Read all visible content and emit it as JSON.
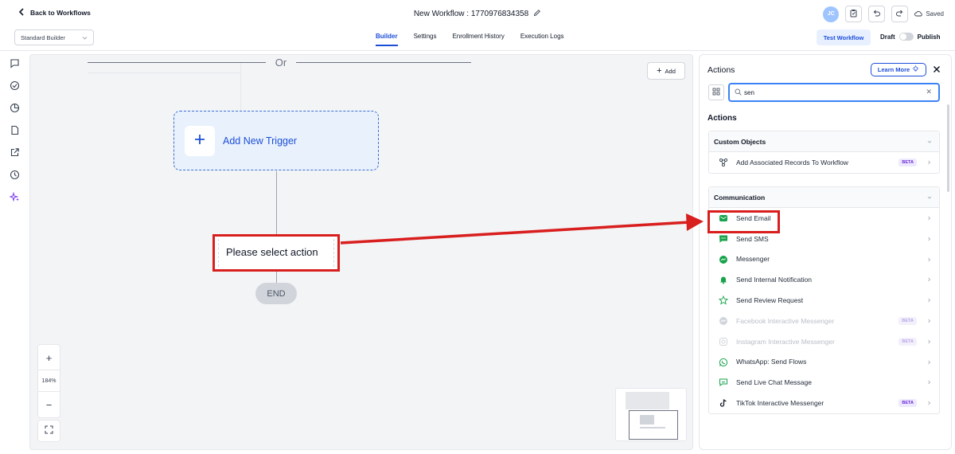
{
  "header": {
    "back_label": "Back to Workflows",
    "workflow_title": "New Workflow : 1770976834358",
    "avatar_initials": "JC",
    "saved_label": "Saved"
  },
  "subbar": {
    "builder_select": "Standard Builder",
    "tabs": [
      {
        "label": "Builder",
        "active": true
      },
      {
        "label": "Settings",
        "active": false
      },
      {
        "label": "Enrollment History",
        "active": false
      },
      {
        "label": "Execution Logs",
        "active": false
      }
    ],
    "test_button": "Test Workflow",
    "draft_label": "Draft",
    "publish_label": "Publish"
  },
  "canvas": {
    "or_label": "Or",
    "add_button": "Add",
    "trigger_label": "Add New Trigger",
    "action_placeholder": "Please select action",
    "end_label": "END",
    "zoom_level": "184%",
    "zoom_in": "+",
    "zoom_out": "−"
  },
  "panel": {
    "title": "Actions",
    "learn_more": "Learn More",
    "search_value": "sen",
    "section_title": "Actions",
    "groups": [
      {
        "title": "Custom Objects",
        "items": [
          {
            "label": "Add Associated Records To Workflow",
            "icon": "share-nodes-icon",
            "badge": "BETA",
            "disabled": false
          }
        ]
      },
      {
        "title": "Communication",
        "items": [
          {
            "label": "Send Email",
            "icon": "email-icon",
            "badge": "",
            "disabled": false
          },
          {
            "label": "Send SMS",
            "icon": "sms-icon",
            "badge": "",
            "disabled": false
          },
          {
            "label": "Messenger",
            "icon": "messenger-icon",
            "badge": "",
            "disabled": false
          },
          {
            "label": "Send Internal Notification",
            "icon": "bell-icon",
            "badge": "",
            "disabled": false
          },
          {
            "label": "Send Review Request",
            "icon": "star-icon",
            "badge": "",
            "disabled": false
          },
          {
            "label": "Facebook Interactive Messenger",
            "icon": "facebook-messenger-icon",
            "badge": "BETA",
            "disabled": true
          },
          {
            "label": "Instagram Interactive Messenger",
            "icon": "instagram-icon",
            "badge": "BETA",
            "disabled": true
          },
          {
            "label": "WhatsApp: Send Flows",
            "icon": "whatsapp-icon",
            "badge": "",
            "disabled": false
          },
          {
            "label": "Send Live Chat Message",
            "icon": "live-chat-icon",
            "badge": "",
            "disabled": false
          },
          {
            "label": "TikTok Interactive Messenger",
            "icon": "tiktok-icon",
            "badge": "BETA",
            "disabled": false
          }
        ]
      }
    ]
  },
  "colors": {
    "accent": "#1d4ed8",
    "annotation_red": "#d91e1e",
    "canvas_bg": "#f3f4f6",
    "trigger_bg": "#e9f2fc",
    "icon_green": "#16a34a"
  }
}
